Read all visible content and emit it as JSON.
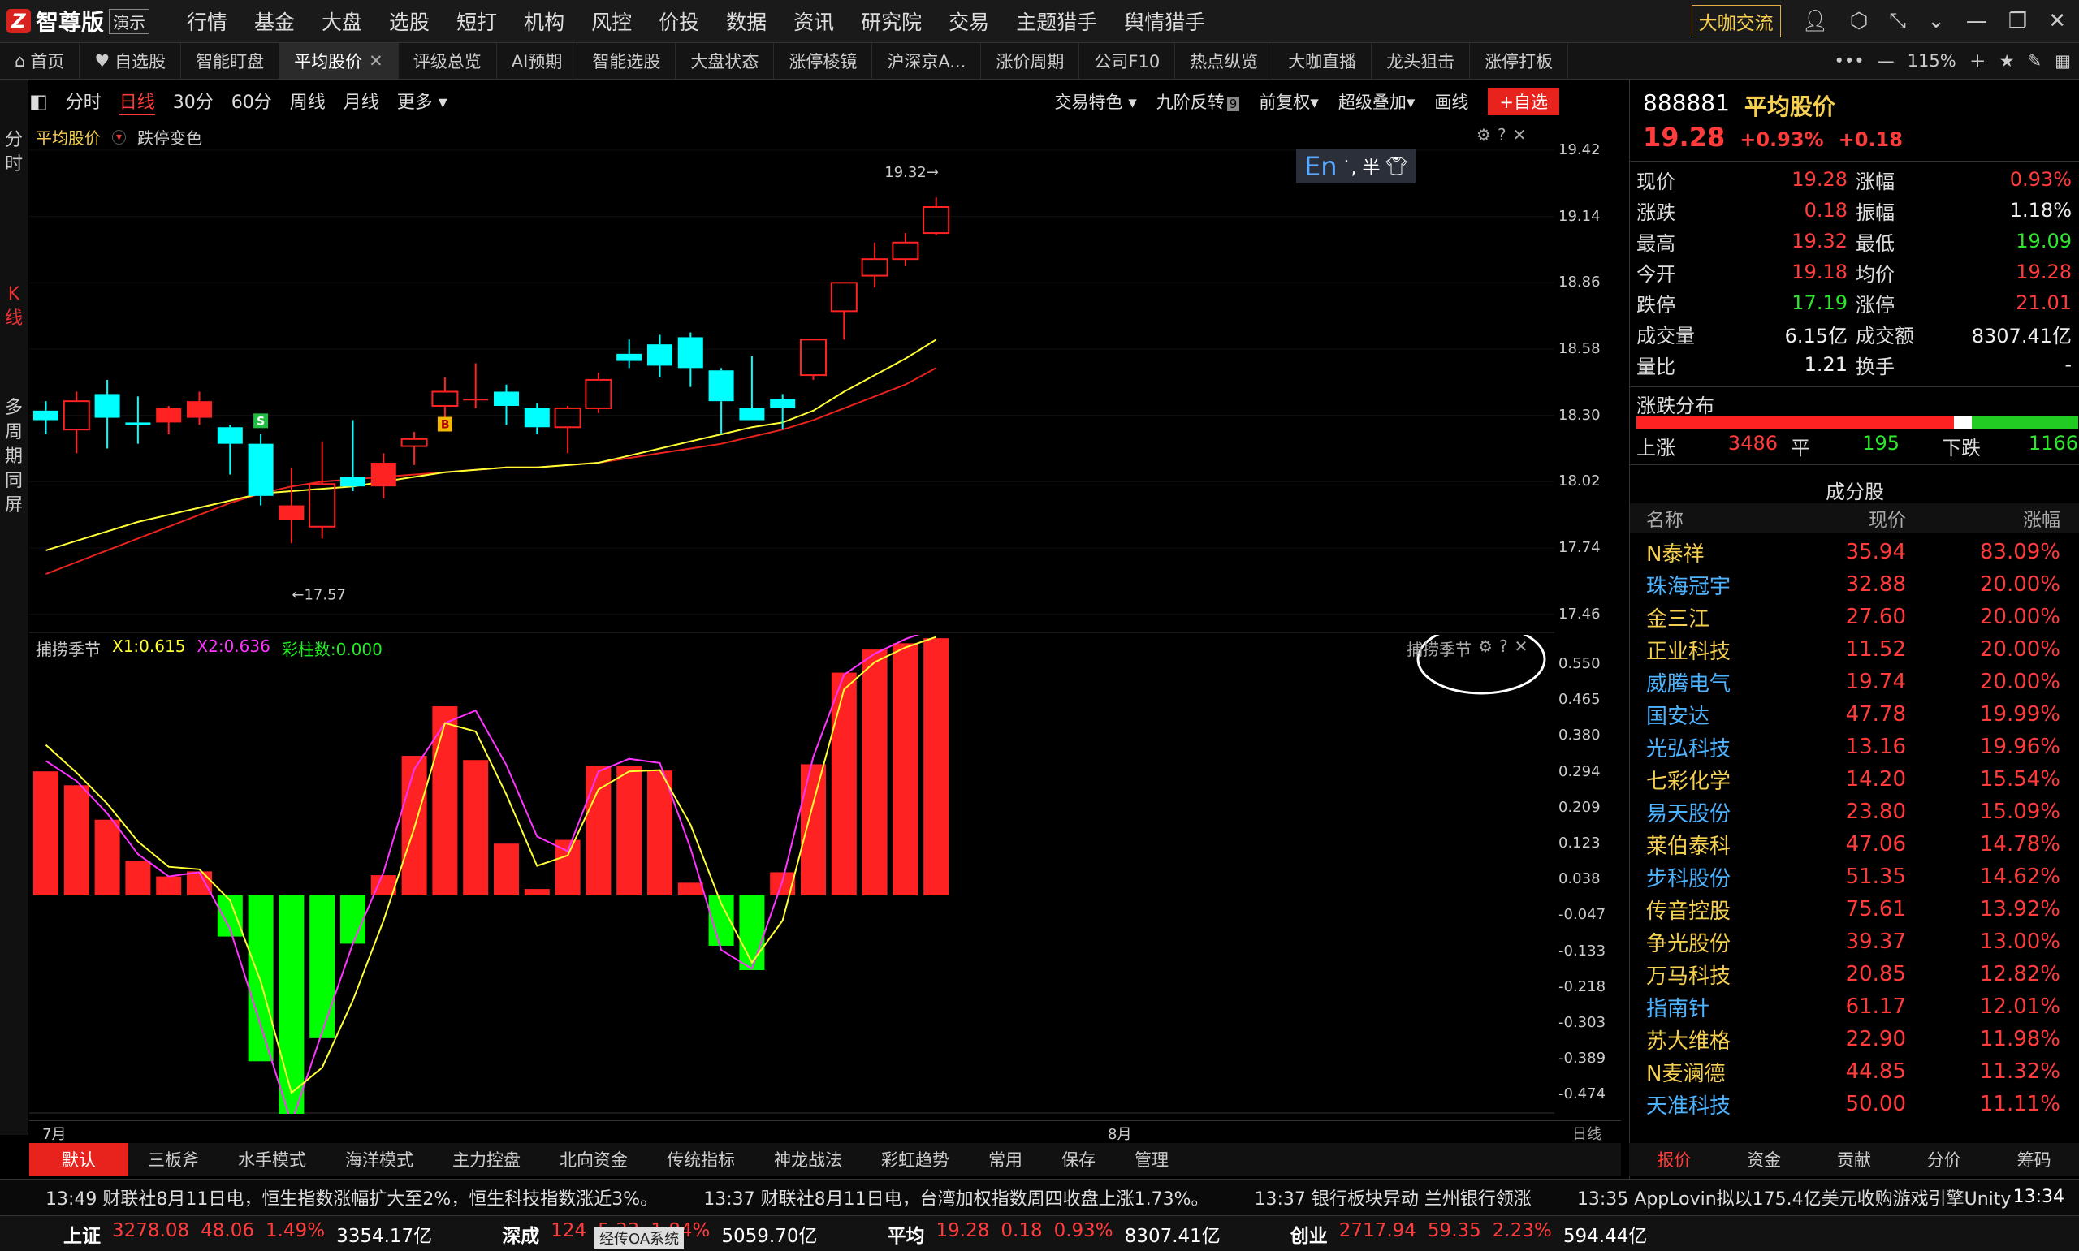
{
  "app": {
    "name": "智尊版",
    "badge": "演示"
  },
  "menu": [
    "行情",
    "基金",
    "大盘",
    "选股",
    "短打",
    "机构",
    "风控",
    "价投",
    "数据",
    "资讯",
    "研究院",
    "交易",
    "主题猎手",
    "舆情猎手"
  ],
  "top_right": {
    "highlight": "大咖交流"
  },
  "tabs": [
    {
      "label": "首页",
      "icon": "home-icon"
    },
    {
      "label": "自选股",
      "icon": "heart-icon"
    },
    {
      "label": "智能盯盘"
    },
    {
      "label": "平均股价",
      "active": true
    },
    {
      "label": "评级总览"
    },
    {
      "label": "AI预期"
    },
    {
      "label": "智能选股"
    },
    {
      "label": "大盘状态"
    },
    {
      "label": "涨停棱镜"
    },
    {
      "label": "沪深京A..."
    },
    {
      "label": "涨价周期"
    },
    {
      "label": "公司F10"
    },
    {
      "label": "热点纵览"
    },
    {
      "label": "大咖直播"
    },
    {
      "label": "龙头狙击"
    },
    {
      "label": "涨停打板"
    }
  ],
  "zoom": "115%",
  "left_strip": {
    "fenshi": [
      "分",
      "时"
    ],
    "kline": [
      "K",
      "线"
    ],
    "multi": [
      "多",
      "周",
      "期",
      "同",
      "屏"
    ]
  },
  "periods": {
    "items": [
      "分时",
      "日线",
      "30分",
      "60分",
      "周线",
      "月线",
      "更多 ▾"
    ],
    "active": "日线"
  },
  "period_tools": [
    "交易特色 ▾",
    "九阶反转",
    "前复权▾",
    "超级叠加▾",
    "画线"
  ],
  "period_badge": "9",
  "add_watch": "+自选",
  "main_legend": {
    "name": "平均股价",
    "option": "跌停变色"
  },
  "ime": {
    "en": "En",
    "rest": "˙, 半"
  },
  "sub_legend": {
    "name": "捕捞季节",
    "x1": "X1:0.615",
    "x2": "X2:0.636",
    "bars": "彩柱数:0.000",
    "corner": "捕捞季节"
  },
  "annotations": {
    "high": "19.32→",
    "low": "←17.57",
    "signal_s": "S",
    "signal_b": "B"
  },
  "x_labels": {
    "july": "7月",
    "august": "8月",
    "right": "日线"
  },
  "chart_data": [
    {
      "type": "candlestick",
      "title": "平均股价",
      "ylim": [
        17.38,
        19.54
      ],
      "y_ticks": [
        "19.42",
        "19.14",
        "18.86",
        "18.58",
        "18.30",
        "18.02",
        "17.74",
        "17.46"
      ],
      "candles": [
        {
          "o": 18.32,
          "c": 18.28,
          "h": 18.36,
          "l": 18.22
        },
        {
          "o": 18.24,
          "c": 18.36,
          "h": 18.4,
          "l": 18.14
        },
        {
          "o": 18.39,
          "c": 18.29,
          "h": 18.45,
          "l": 18.16
        },
        {
          "o": 18.27,
          "c": 18.26,
          "h": 18.38,
          "l": 18.18
        },
        {
          "o": 18.27,
          "c": 18.33,
          "h": 18.34,
          "l": 18.22
        },
        {
          "o": 18.29,
          "c": 18.36,
          "h": 18.4,
          "l": 18.26
        },
        {
          "o": 18.25,
          "c": 18.18,
          "h": 18.26,
          "l": 18.05
        },
        {
          "o": 18.18,
          "c": 17.96,
          "h": 18.22,
          "l": 17.92
        },
        {
          "o": 17.86,
          "c": 17.92,
          "h": 18.08,
          "l": 17.76
        },
        {
          "o": 17.83,
          "c": 18.01,
          "h": 18.19,
          "l": 17.78
        },
        {
          "o": 18.04,
          "c": 18.0,
          "h": 18.28,
          "l": 17.98
        },
        {
          "o": 18.0,
          "c": 18.1,
          "h": 18.14,
          "l": 17.95
        },
        {
          "o": 18.17,
          "c": 18.2,
          "h": 18.23,
          "l": 18.09
        },
        {
          "o": 18.34,
          "c": 18.4,
          "h": 18.46,
          "l": 18.28
        },
        {
          "o": 18.37,
          "c": 18.37,
          "h": 18.52,
          "l": 18.33
        },
        {
          "o": 18.4,
          "c": 18.34,
          "h": 18.43,
          "l": 18.26
        },
        {
          "o": 18.33,
          "c": 18.25,
          "h": 18.35,
          "l": 18.22
        },
        {
          "o": 18.25,
          "c": 18.33,
          "h": 18.34,
          "l": 18.14
        },
        {
          "o": 18.33,
          "c": 18.45,
          "h": 18.48,
          "l": 18.31
        },
        {
          "o": 18.56,
          "c": 18.53,
          "h": 18.62,
          "l": 18.5
        },
        {
          "o": 18.6,
          "c": 18.51,
          "h": 18.64,
          "l": 18.46
        },
        {
          "o": 18.63,
          "c": 18.5,
          "h": 18.65,
          "l": 18.42
        },
        {
          "o": 18.49,
          "c": 18.36,
          "h": 18.5,
          "l": 18.22
        },
        {
          "o": 18.33,
          "c": 18.28,
          "h": 18.55,
          "l": 18.28
        },
        {
          "o": 18.37,
          "c": 18.33,
          "h": 18.39,
          "l": 18.24
        },
        {
          "o": 18.47,
          "c": 18.62,
          "h": 18.62,
          "l": 18.45
        },
        {
          "o": 18.74,
          "c": 18.86,
          "h": 18.86,
          "l": 18.62
        },
        {
          "o": 18.89,
          "c": 18.96,
          "h": 19.03,
          "l": 18.84
        },
        {
          "o": 18.96,
          "c": 19.03,
          "h": 19.07,
          "l": 18.93
        },
        {
          "o": 19.07,
          "c": 19.18,
          "h": 19.22,
          "l": 19.06
        }
      ],
      "ma_yellow": [
        17.73,
        17.77,
        17.81,
        17.85,
        17.88,
        17.91,
        17.94,
        17.97,
        17.98,
        17.99,
        18.0,
        18.02,
        18.04,
        18.06,
        18.07,
        18.08,
        18.08,
        18.09,
        18.1,
        18.13,
        18.16,
        18.19,
        18.22,
        18.25,
        18.27,
        18.32,
        18.4,
        18.47,
        18.54,
        18.62
      ],
      "ma_red": [
        17.63,
        17.68,
        17.73,
        17.78,
        17.83,
        17.88,
        17.93,
        17.97,
        18.0,
        18.02,
        18.03,
        18.04,
        18.05,
        18.06,
        18.07,
        18.08,
        18.08,
        18.09,
        18.1,
        18.12,
        18.14,
        18.16,
        18.18,
        18.21,
        18.24,
        18.28,
        18.33,
        18.38,
        18.43,
        18.5
      ]
    },
    {
      "type": "bar",
      "title": "捕捞季节",
      "ylim": [
        -0.52,
        0.62
      ],
      "y_ticks": [
        "0.550",
        "0.465",
        "0.380",
        "0.294",
        "0.209",
        "0.123",
        "0.038",
        "-0.047",
        "-0.133",
        "-0.218",
        "-0.303",
        "-0.389",
        "-0.474"
      ],
      "values": [
        0.295,
        0.262,
        0.18,
        0.082,
        0.045,
        0.057,
        -0.098,
        -0.395,
        -0.53,
        -0.34,
        -0.115,
        0.048,
        0.332,
        0.45,
        0.322,
        0.123,
        0.015,
        0.132,
        0.308,
        0.308,
        0.297,
        0.03,
        -0.12,
        -0.178,
        0.055,
        0.312,
        0.53,
        0.585,
        0.6,
        0.612
      ],
      "series": [
        {
          "name": "X1",
          "values": [
            0.358,
            0.292,
            0.218,
            0.128,
            0.068,
            0.062,
            -0.012,
            -0.205,
            -0.47,
            -0.41,
            -0.25,
            -0.06,
            0.16,
            0.41,
            0.39,
            0.24,
            0.07,
            0.095,
            0.252,
            0.295,
            0.298,
            0.168,
            -0.02,
            -0.16,
            -0.06,
            0.22,
            0.49,
            0.555,
            0.59,
            0.615
          ]
        },
        {
          "name": "X2",
          "values": [
            0.32,
            0.272,
            0.195,
            0.098,
            0.045,
            0.055,
            -0.08,
            -0.31,
            -0.542,
            -0.325,
            -0.115,
            0.055,
            0.3,
            0.41,
            0.44,
            0.31,
            0.14,
            0.105,
            0.295,
            0.325,
            0.315,
            0.112,
            -0.13,
            -0.175,
            0.035,
            0.33,
            0.525,
            0.575,
            0.61,
            0.636
          ]
        }
      ]
    }
  ],
  "quote": {
    "code": "888881",
    "name": "平均股价",
    "price": "19.28",
    "pct": "+0.93%",
    "chg": "+0.18",
    "rows": [
      {
        "l1": "现价",
        "v1": "19.28",
        "c1": "red",
        "l2": "涨幅",
        "v2": "0.93%",
        "c2": "red"
      },
      {
        "l1": "涨跌",
        "v1": "0.18",
        "c1": "red",
        "l2": "振幅",
        "v2": "1.18%",
        "c2": "white"
      },
      {
        "l1": "最高",
        "v1": "19.32",
        "c1": "red",
        "l2": "最低",
        "v2": "19.09",
        "c2": "green"
      },
      {
        "l1": "今开",
        "v1": "19.18",
        "c1": "red",
        "l2": "均价",
        "v2": "19.28",
        "c2": "red"
      },
      {
        "l1": "跌停",
        "v1": "17.19",
        "c1": "green",
        "l2": "涨停",
        "v2": "21.01",
        "c2": "red"
      },
      {
        "l1": "成交量",
        "v1": "6.15亿",
        "c1": "white",
        "l2": "成交额",
        "v2": "8307.41亿",
        "c2": "white"
      },
      {
        "l1": "量比",
        "v1": "1.21",
        "c1": "white",
        "l2": "换手",
        "v2": "-",
        "c2": "white"
      }
    ],
    "distribution": {
      "title": "涨跌分布",
      "up_label": "上涨",
      "up": "3486",
      "flat_label": "平",
      "flat": "195",
      "down_label": "下跌",
      "down": "1166",
      "up_n": 3486,
      "flat_n": 195,
      "down_n": 1166
    }
  },
  "constituents": {
    "title": "成分股",
    "headers": [
      "名称",
      "现价",
      "涨幅"
    ],
    "rows": [
      {
        "name": "N泰祥",
        "price": "35.94",
        "pct": "83.09%",
        "color": "#f5cf4f"
      },
      {
        "name": "珠海冠宇",
        "price": "32.88",
        "pct": "20.00%",
        "color": "#4db3ff"
      },
      {
        "name": "金三江",
        "price": "27.60",
        "pct": "20.00%",
        "color": "#f5cf4f"
      },
      {
        "name": "正业科技",
        "price": "11.52",
        "pct": "20.00%",
        "color": "#f5cf4f"
      },
      {
        "name": "威腾电气",
        "price": "19.74",
        "pct": "20.00%",
        "color": "#4db3ff"
      },
      {
        "name": "国安达",
        "price": "47.78",
        "pct": "19.99%",
        "color": "#4db3ff"
      },
      {
        "name": "光弘科技",
        "price": "13.16",
        "pct": "19.96%",
        "color": "#4db3ff"
      },
      {
        "name": "七彩化学",
        "price": "14.20",
        "pct": "15.54%",
        "color": "#f5cf4f"
      },
      {
        "name": "易天股份",
        "price": "23.80",
        "pct": "15.09%",
        "color": "#4db3ff"
      },
      {
        "name": "莱伯泰科",
        "price": "47.06",
        "pct": "14.78%",
        "color": "#f5cf4f"
      },
      {
        "name": "步科股份",
        "price": "51.35",
        "pct": "14.62%",
        "color": "#4db3ff"
      },
      {
        "name": "传音控股",
        "price": "75.61",
        "pct": "13.92%",
        "color": "#f5cf4f"
      },
      {
        "name": "争光股份",
        "price": "39.37",
        "pct": "13.00%",
        "color": "#f5cf4f"
      },
      {
        "name": "万马科技",
        "price": "20.85",
        "pct": "12.82%",
        "color": "#f5cf4f"
      },
      {
        "name": "指南针",
        "price": "61.17",
        "pct": "12.01%",
        "color": "#4db3ff"
      },
      {
        "name": "苏大维格",
        "price": "22.90",
        "pct": "11.98%",
        "color": "#f5cf4f"
      },
      {
        "name": "N麦澜德",
        "price": "44.85",
        "pct": "11.32%",
        "color": "#f5cf4f"
      },
      {
        "name": "天准科技",
        "price": "50.00",
        "pct": "11.11%",
        "color": "#4db3ff"
      }
    ]
  },
  "bottom_tabs": {
    "items": [
      "默认",
      "三板斧",
      "水手模式",
      "海洋模式",
      "主力控盘",
      "北向资金",
      "传统指标",
      "神龙战法",
      "彩虹趋势",
      "常用",
      "保存",
      "管理"
    ],
    "active": "默认"
  },
  "right_bottom_tabs": [
    "报价",
    "资金",
    "贡献",
    "分价",
    "筹码"
  ],
  "news": [
    "13:49 财联社8月11日电，恒生指数涨幅扩大至2%，恒生科技指数涨近3%。",
    "13:37 财联社8月11日电，台湾加权指数周四收盘上涨1.73%。",
    "13:37 银行板块异动 兰州银行领涨",
    "13:35 AppLovin拟以175.4亿美元收购游戏引擎Unity"
  ],
  "time": "13:34",
  "indices": [
    {
      "name": "上证",
      "price": "3278.08",
      "chg": "48.06",
      "pct": "1.49%",
      "amt": "3354.17亿"
    },
    {
      "name": "深成",
      "price": "124",
      "chg": "5.33",
      "pct": "1.84%",
      "amt": "5059.70亿"
    },
    {
      "name": "平均",
      "price": "19.28",
      "chg": "0.18",
      "pct": "0.93%",
      "amt": "8307.41亿"
    },
    {
      "name": "创业",
      "price": "2717.94",
      "chg": "59.35",
      "pct": "2.23%",
      "amt": "594.44亿"
    }
  ],
  "overlay_tag": "经传OA系统",
  "colors": {
    "up": "#ff2222",
    "down": "#00ffff",
    "green_bar": "#00ff00",
    "yellow": "#ffff33",
    "magenta": "#ff33ff",
    "ma_red": "#e8231e"
  }
}
